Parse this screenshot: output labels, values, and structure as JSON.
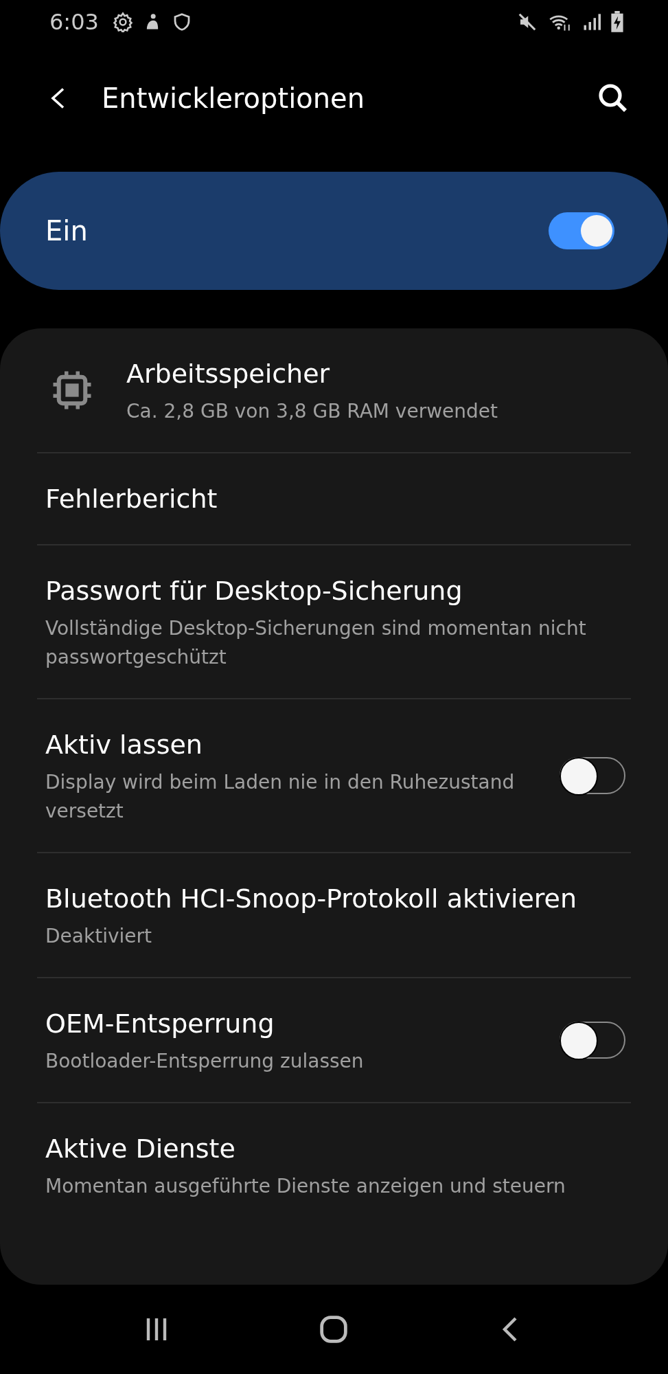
{
  "status_bar": {
    "time": "6:03"
  },
  "header": {
    "title": "Entwickleroptionen"
  },
  "master_switch": {
    "label": "Ein",
    "on": true
  },
  "items": [
    {
      "kind": "icon",
      "title": "Arbeitsspeicher",
      "subtitle": "Ca. 2,8 GB von 3,8 GB RAM verwendet"
    },
    {
      "kind": "plain",
      "title": "Fehlerbericht"
    },
    {
      "kind": "plain",
      "title": "Passwort für Desktop-Sicherung",
      "subtitle": "Vollständige Desktop-Sicherungen sind momentan nicht passwortgeschützt"
    },
    {
      "kind": "toggle",
      "title": "Aktiv lassen",
      "subtitle": "Display wird beim Laden nie in den Ruhezustand versetzt",
      "on": false
    },
    {
      "kind": "plain",
      "title": "Bluetooth HCI-Snoop-Protokoll aktivieren",
      "subtitle": "Deaktiviert"
    },
    {
      "kind": "toggle",
      "title": "OEM-Entsperrung",
      "subtitle": "Bootloader-Entsperrung zulassen",
      "on": false
    },
    {
      "kind": "plain",
      "title": "Aktive Dienste",
      "subtitle": "Momentan ausgeführte Dienste anzeigen und steuern"
    }
  ]
}
